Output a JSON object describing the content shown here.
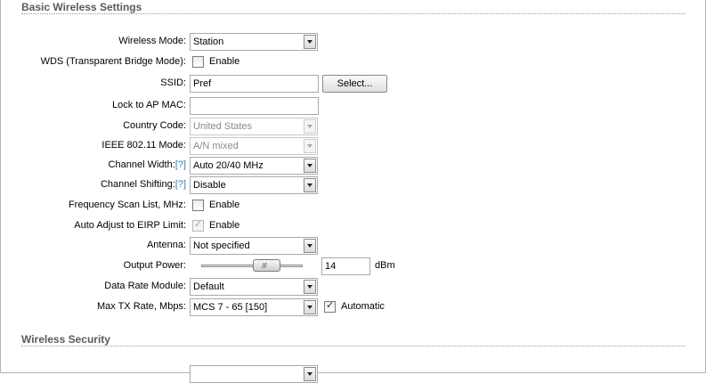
{
  "sections": {
    "basic_title": "Basic Wireless Settings",
    "security_title": "Wireless Security"
  },
  "fields": {
    "wireless_mode": {
      "label": "Wireless Mode:",
      "value": "Station"
    },
    "wds": {
      "label": "WDS (Transparent Bridge Mode):",
      "option_label": "Enable",
      "checked": false
    },
    "ssid": {
      "label": "SSID:",
      "value": "Pref",
      "button_label": "Select..."
    },
    "lock_ap_mac": {
      "label": "Lock to AP MAC:",
      "value": ""
    },
    "country_code": {
      "label": "Country Code:",
      "value": "United States",
      "disabled": true
    },
    "ieee_mode": {
      "label": "IEEE 802.11 Mode:",
      "value": "A/N mixed",
      "disabled": true
    },
    "channel_width": {
      "label": "Channel Width:",
      "help": "[?]",
      "value": "Auto 20/40 MHz"
    },
    "channel_shifting": {
      "label": "Channel Shifting:",
      "help": "[?]",
      "value": "Disable"
    },
    "freq_scan_list": {
      "label": "Frequency Scan List, MHz:",
      "option_label": "Enable",
      "checked": false
    },
    "auto_adjust_eirp": {
      "label": "Auto Adjust to EIRP Limit:",
      "option_label": "Enable",
      "checked": true,
      "disabled": true
    },
    "antenna": {
      "label": "Antenna:",
      "value": "Not specified"
    },
    "output_power": {
      "label": "Output Power:",
      "value": "14",
      "unit": "dBm",
      "thumb_grip": "////"
    },
    "data_rate_module": {
      "label": "Data Rate Module:",
      "value": "Default"
    },
    "max_tx_rate": {
      "label": "Max TX Rate, Mbps:",
      "value": "MCS 7 - 65 [150]",
      "option_label": "Automatic",
      "checked": true
    }
  },
  "icons": {
    "check_glyph": "✓"
  }
}
